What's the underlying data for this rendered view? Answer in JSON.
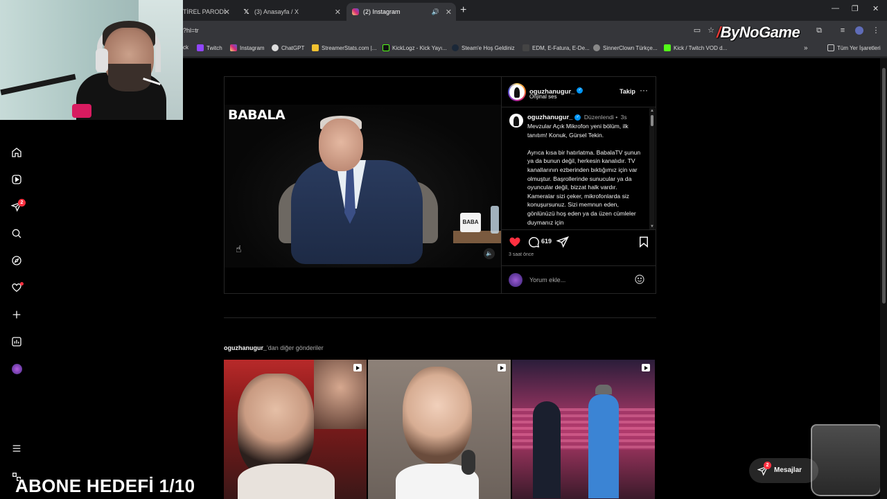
{
  "browser": {
    "tabs": [
      {
        "title": "TİREL PARODİ"
      },
      {
        "title": "(3) Anasayfa / X"
      },
      {
        "title": "(2) Instagram"
      }
    ],
    "url": "?hl=tr",
    "bookmarks": [
      {
        "label": "ck"
      },
      {
        "label": "Twitch"
      },
      {
        "label": "Instagram"
      },
      {
        "label": "ChatGPT"
      },
      {
        "label": "StreamerStats.com |..."
      },
      {
        "label": "KickLogz - Kick Yayı..."
      },
      {
        "label": "Steam'e Hoş Geldiniz"
      },
      {
        "label": "EDM, E-Fatura, E-De..."
      },
      {
        "label": "SinnerClown Türkçe..."
      },
      {
        "label": "Kick / Twitch VOD d..."
      }
    ],
    "all_bookmarks": "Tüm Yer İşaretleri",
    "overflow": "»"
  },
  "overlay": {
    "logo": "ByNoGame",
    "abone": "ABONE HEDEFİ 1/10"
  },
  "sidebar": {
    "notifications_badge": "2"
  },
  "post": {
    "video_logo": "BABALA",
    "mug_text": "BABA",
    "username": "oguzhanugur_",
    "audio": "Orijinal ses",
    "follow": "Takip",
    "more": "···",
    "edited": "Düzenlendi",
    "dot": "•",
    "age": "3s",
    "caption": "Mevzular Açık Mikrofon yeni bölüm, ilk tanıtım! Konuk, Gürsel Tekin.\n\nAyrıca kısa bir hatırlatma. BabalaTV şunun ya da bunun değil, herkesin kanalıdır. TV kanallarının ezberinden bıktığımız için var olmuştur. Başrollerinde sunucular ya da oyuncular değil, bizzat halk vardır. Kameralar sizi çeker, mikrofonlarda siz konuşursunuz. Sizi memnun eden, gönlünüzü hoş eden ya da üzen cümleler duymanız için",
    "comments_count": "619",
    "time_ago": "3 saat önce",
    "comment_placeholder": "Yorum ekle..."
  },
  "more_posts": {
    "username": "oguzhanugur_",
    "suffix": "'dan diğer gönderiler"
  },
  "messages": {
    "label": "Mesajlar",
    "badge": "2"
  },
  "colors": {
    "like": "#ff3040",
    "verified": "#0095f6",
    "badge": "#ff3040"
  }
}
